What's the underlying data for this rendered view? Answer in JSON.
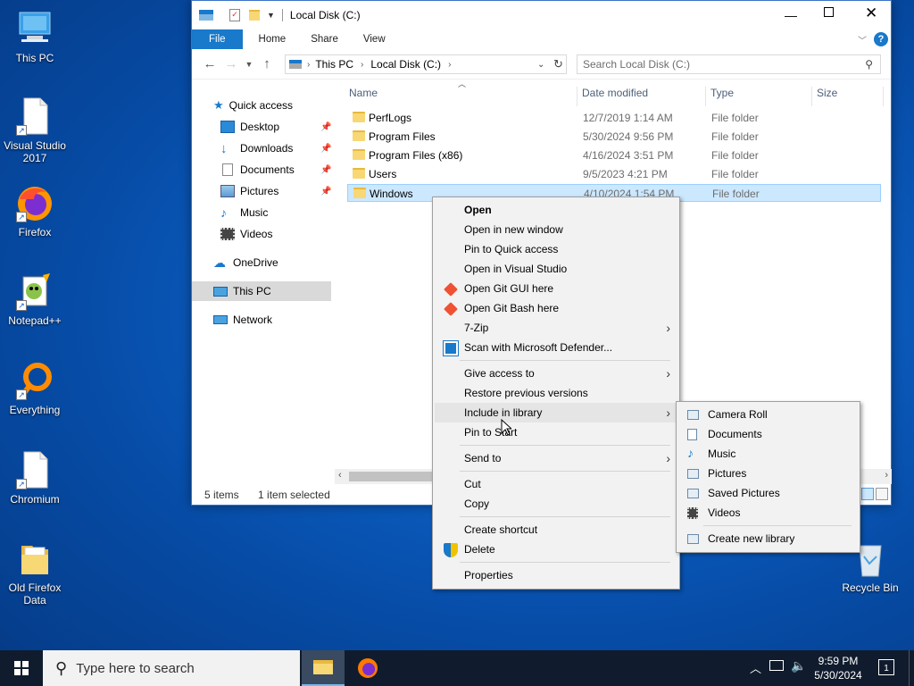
{
  "desktop": {
    "icons": [
      {
        "label": "This PC",
        "icon": "this-pc-icon"
      },
      {
        "label": "Visual Studio 2017",
        "icon": "blank-file-icon"
      },
      {
        "label": "Firefox",
        "icon": "firefox-icon"
      },
      {
        "label": "Notepad++",
        "icon": "notepad-plus-plus-icon"
      },
      {
        "label": "Everything",
        "icon": "everything-search-icon"
      },
      {
        "label": "Chromium",
        "icon": "blank-file-icon"
      },
      {
        "label": "Old Firefox Data",
        "icon": "folder-icon"
      },
      {
        "label": "Recycle Bin",
        "icon": "recycle-bin-icon"
      }
    ]
  },
  "window": {
    "title": "Local Disk (C:)",
    "ribbon_tabs": [
      "File",
      "Home",
      "Share",
      "View"
    ],
    "address": {
      "segments": [
        "This PC",
        "Local Disk (C:)"
      ]
    },
    "search_placeholder": "Search Local Disk (C:)",
    "nav": {
      "quick_access": "Quick access",
      "items": [
        {
          "label": "Desktop",
          "pinned": true
        },
        {
          "label": "Downloads",
          "pinned": true
        },
        {
          "label": "Documents",
          "pinned": true
        },
        {
          "label": "Pictures",
          "pinned": true
        },
        {
          "label": "Music",
          "pinned": false
        },
        {
          "label": "Videos",
          "pinned": false
        }
      ],
      "onedrive": "OneDrive",
      "this_pc": "This PC",
      "network": "Network"
    },
    "columns": [
      "Name",
      "Date modified",
      "Type",
      "Size"
    ],
    "files": [
      {
        "name": "PerfLogs",
        "date": "12/7/2019 1:14 AM",
        "type": "File folder"
      },
      {
        "name": "Program Files",
        "date": "5/30/2024 9:56 PM",
        "type": "File folder"
      },
      {
        "name": "Program Files (x86)",
        "date": "4/16/2024 3:51 PM",
        "type": "File folder"
      },
      {
        "name": "Users",
        "date": "9/5/2023 4:21 PM",
        "type": "File folder"
      },
      {
        "name": "Windows",
        "date": "4/10/2024 1:54 PM",
        "type": "File folder",
        "selected": true
      }
    ],
    "status": {
      "items": "5 items",
      "selected": "1 item selected"
    }
  },
  "context_menu": {
    "items": [
      "Open",
      "Open in new window",
      "Pin to Quick access",
      "Open in Visual Studio",
      "Open Git GUI here",
      "Open Git Bash here",
      "7-Zip",
      "Scan with Microsoft Defender...",
      "Give access to",
      "Restore previous versions",
      "Include in library",
      "Pin to Start",
      "Send to",
      "Cut",
      "Copy",
      "Create shortcut",
      "Delete",
      "Properties"
    ]
  },
  "submenu": {
    "items": [
      "Camera Roll",
      "Documents",
      "Music",
      "Pictures",
      "Saved Pictures",
      "Videos",
      "Create new library"
    ]
  },
  "taskbar": {
    "search_placeholder": "Type here to search",
    "time": "9:59 PM",
    "date": "5/30/2024",
    "notifications": "1"
  },
  "colors": {
    "accent": "#1979ca",
    "selection": "#cce8ff",
    "taskbar": "#101c2d"
  }
}
